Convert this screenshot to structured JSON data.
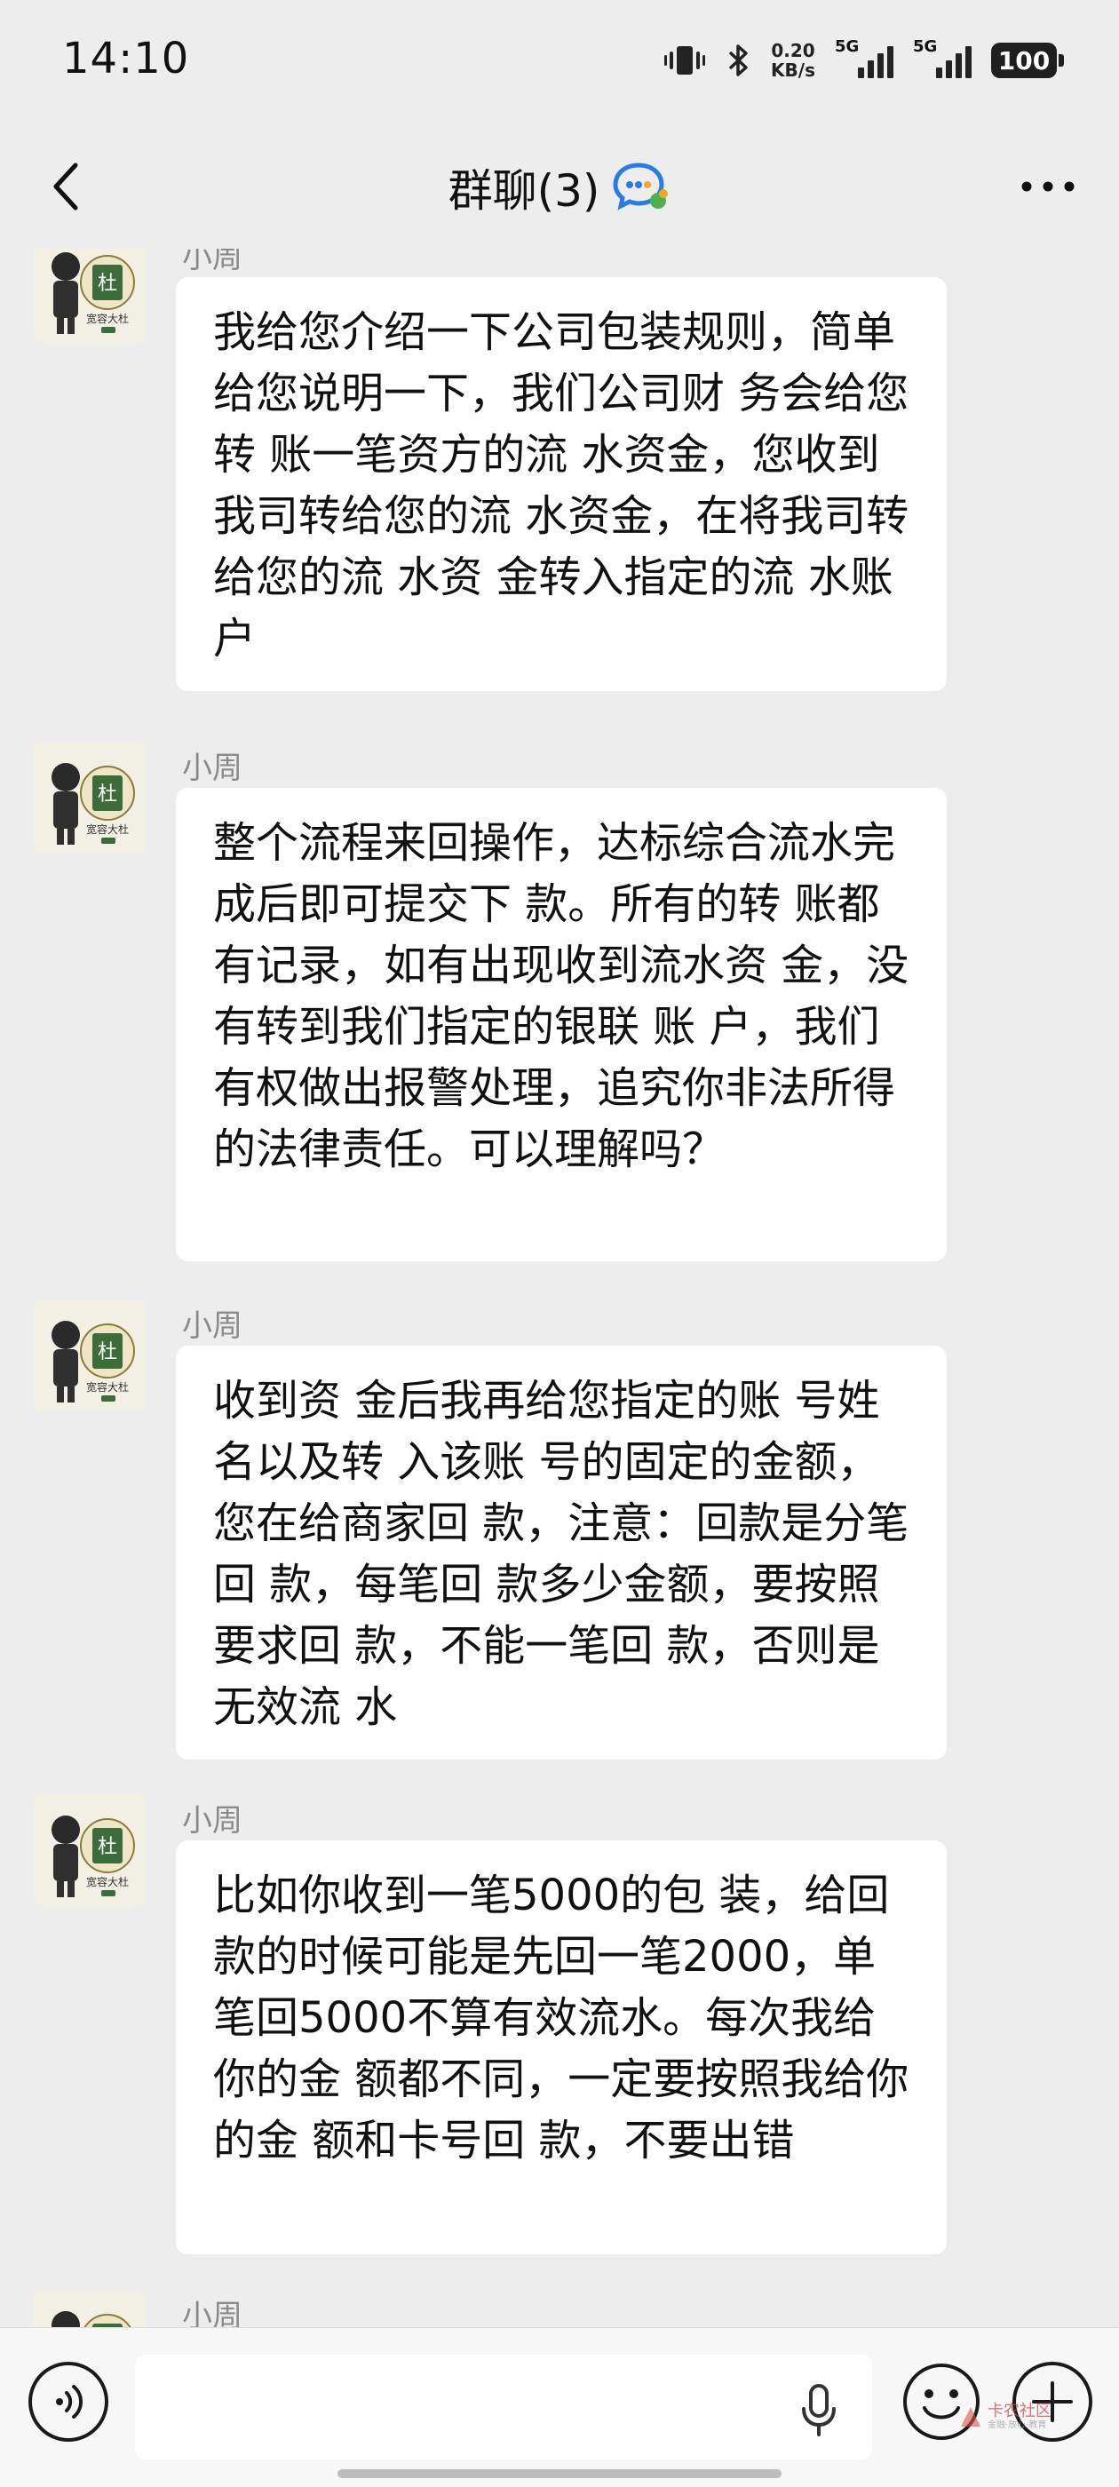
{
  "status_bar": {
    "time": "14:10",
    "net_speed_value": "0.20",
    "net_speed_unit": "KB/s",
    "sim1": "5G",
    "sim2": "5G",
    "battery": "100"
  },
  "header": {
    "title": "群聊(3)"
  },
  "messages": [
    {
      "sender": "小周",
      "avatar_caption": "宽容大杜",
      "avatar_char": "杜",
      "text": "我给您介绍一下公司包装规则，简单给您说明一下，我们公司财 务会给您转 账一笔资方的流 水资金，您收到我司转给您的流 水资金，在将我司转给您的流 水资 金转入指定的流 水账 户"
    },
    {
      "sender": "小周",
      "avatar_caption": "宽容大杜",
      "avatar_char": "杜",
      "text": "整个流程来回操作，达标综合流水完成后即可提交下 款。所有的转 账都有记录，如有出现收到流水资 金，没有转到我们指定的银联 账 户，我们有权做出报警处理，追究你非法所得的法律责任。可以理解吗？"
    },
    {
      "sender": "小周",
      "avatar_caption": "宽容大杜",
      "avatar_char": "杜",
      "text": "收到资 金后我再给您指定的账 号姓名以及转 入该账 号的固定的金额，您在给商家回 款，注意：回款是分笔回 款，每笔回 款多少金额，要按照要求回 款，不能一笔回 款，否则是无效流 水"
    },
    {
      "sender": "小周",
      "avatar_caption": "宽容大杜",
      "avatar_char": "杜",
      "text": "比如你收到一笔5000的包 装，给回 款的时候可能是先回一笔2000，单笔回5000不算有效流水。每次我给你的金 额都不同，一定要按照我给你的金 额和卡号回 款，不要出错"
    },
    {
      "sender": "小周",
      "avatar_caption": "宽容大杜",
      "avatar_char": "杜",
      "text": ""
    }
  ],
  "input_bar": {
    "placeholder": "",
    "value": ""
  },
  "watermark": {
    "text": "卡农社区",
    "sub": "金融·放心·教育"
  },
  "colors": {
    "background": "#EDEDED",
    "bubble": "#FFFFFF",
    "sender": "#8A8A8A",
    "avatar_green": "#3E6B3A"
  },
  "icons": [
    "back-arrow-icon",
    "group-chat-icon",
    "more-icon",
    "voice-icon",
    "mic-icon",
    "emoji-icon",
    "plus-icon"
  ]
}
